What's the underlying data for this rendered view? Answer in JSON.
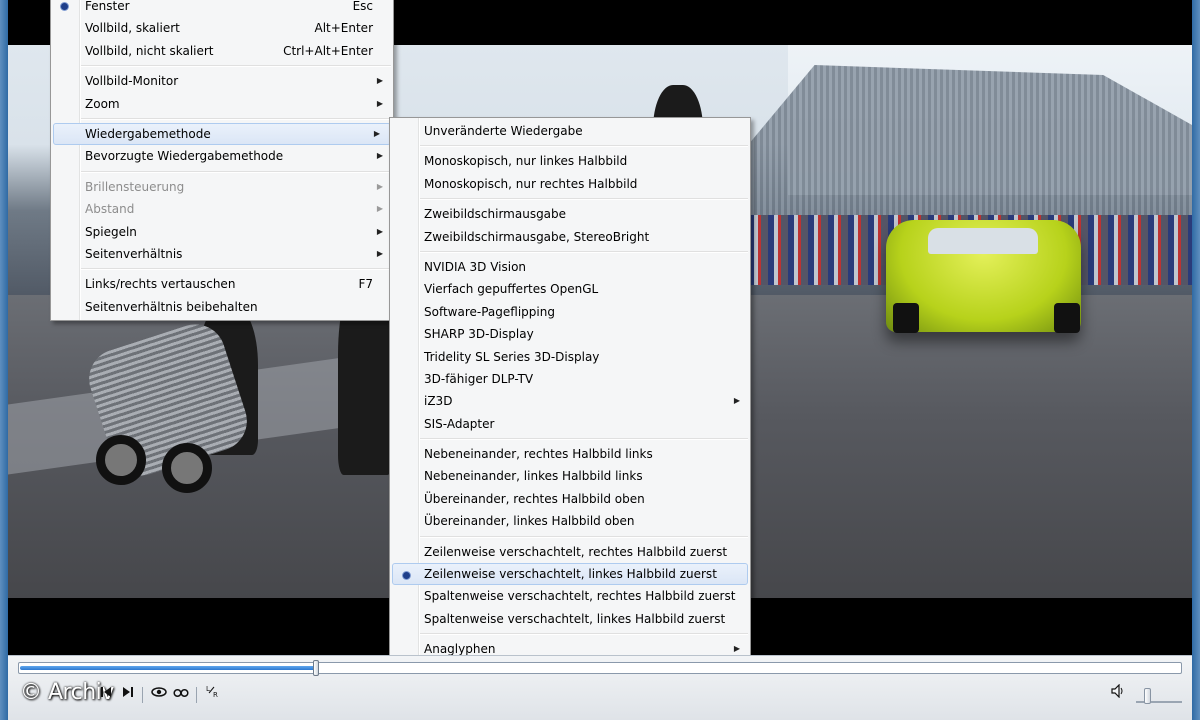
{
  "main_menu": {
    "items": [
      {
        "label": "Fenster",
        "shortcut": "Esc",
        "checked": true
      },
      {
        "label": "Vollbild, skaliert",
        "shortcut": "Alt+Enter"
      },
      {
        "label": "Vollbild, nicht skaliert",
        "shortcut": "Ctrl+Alt+Enter"
      },
      {
        "separator": true
      },
      {
        "label": "Vollbild-Monitor",
        "submenu": true
      },
      {
        "label": "Zoom",
        "submenu": true
      },
      {
        "separator": true
      },
      {
        "label": "Wiedergabemethode",
        "submenu": true,
        "highlighted": true
      },
      {
        "label": "Bevorzugte Wiedergabemethode",
        "submenu": true
      },
      {
        "separator": true
      },
      {
        "label": "Brillensteuerung",
        "submenu": true,
        "disabled": true
      },
      {
        "label": "Abstand",
        "submenu": true,
        "disabled": true
      },
      {
        "label": "Spiegeln",
        "submenu": true
      },
      {
        "label": "Seitenverhältnis",
        "submenu": true
      },
      {
        "separator": true
      },
      {
        "label": "Links/rechts vertauschen",
        "shortcut": "F7"
      },
      {
        "label": "Seitenverhältnis beibehalten"
      }
    ]
  },
  "submenu": {
    "items": [
      {
        "label": "Unveränderte Wiedergabe"
      },
      {
        "separator": true
      },
      {
        "label": "Monoskopisch, nur linkes Halbbild"
      },
      {
        "label": "Monoskopisch, nur rechtes Halbbild"
      },
      {
        "separator": true
      },
      {
        "label": "Zweibildschirmausgabe"
      },
      {
        "label": "Zweibildschirmausgabe, StereoBright"
      },
      {
        "separator": true
      },
      {
        "label": "NVIDIA 3D Vision"
      },
      {
        "label": "Vierfach gepuffertes OpenGL"
      },
      {
        "label": "Software-Pageflipping"
      },
      {
        "label": "SHARP 3D-Display"
      },
      {
        "label": "Tridelity SL Series 3D-Display"
      },
      {
        "label": "3D-fähiger DLP-TV"
      },
      {
        "label": "iZ3D",
        "submenu": true
      },
      {
        "label": "SIS-Adapter"
      },
      {
        "separator": true
      },
      {
        "label": "Nebeneinander, rechtes Halbbild links"
      },
      {
        "label": "Nebeneinander, linkes Halbbild links"
      },
      {
        "label": "Übereinander, rechtes Halbbild oben"
      },
      {
        "label": "Übereinander, linkes Halbbild oben"
      },
      {
        "separator": true
      },
      {
        "label": "Zeilenweise verschachtelt, rechtes Halbbild zuerst"
      },
      {
        "label": "Zeilenweise verschachtelt, linkes Halbbild zuerst",
        "checked": true,
        "highlighted": true
      },
      {
        "label": "Spaltenweise verschachtelt, rechtes Halbbild zuerst"
      },
      {
        "label": "Spaltenweise verschachtelt, linkes Halbbild zuerst"
      },
      {
        "separator": true
      },
      {
        "label": "Anaglyphen",
        "submenu": true
      }
    ]
  },
  "controls": {
    "watermark": "© Archiv",
    "seek_progress": 0.255,
    "volume_level": 0.2,
    "icons": [
      "prev-icon",
      "next-icon",
      "eye-icon",
      "glasses-icon",
      "swap-lr-icon",
      "volume-icon"
    ]
  }
}
